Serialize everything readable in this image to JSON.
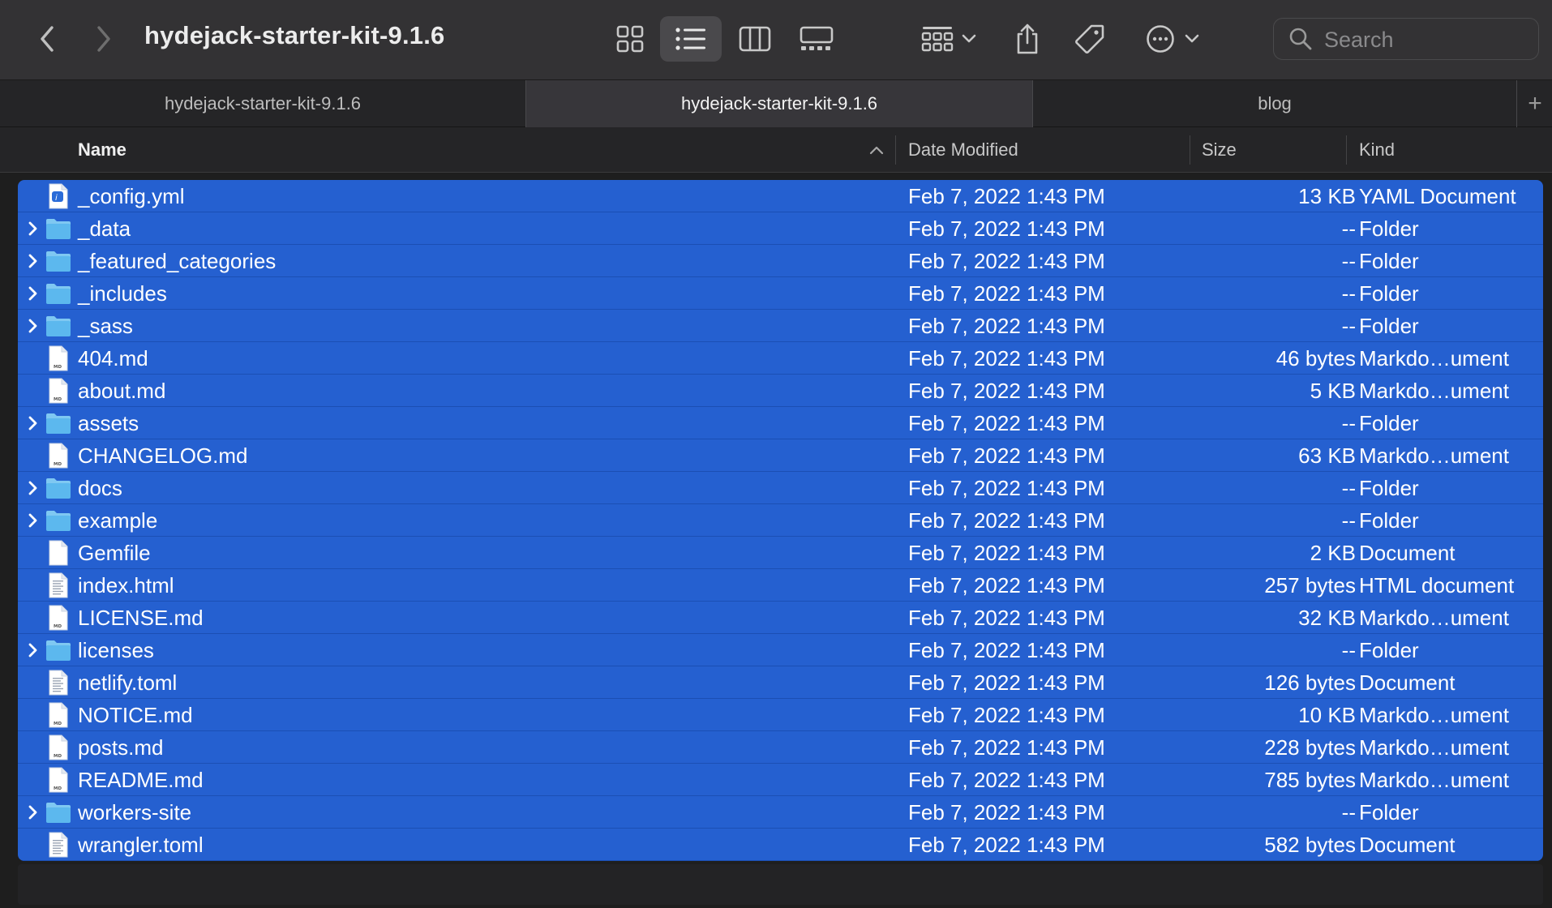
{
  "window": {
    "title": "hydejack-starter-kit-9.1.6"
  },
  "toolbar": {
    "back_icon": "chevron-left-icon",
    "forward_icon": "chevron-right-icon",
    "view_modes": [
      "icon-view-icon",
      "list-view-icon",
      "column-view-icon",
      "gallery-view-icon"
    ],
    "active_view": "list-view-icon",
    "group_icon": "group-icon",
    "share_icon": "share-icon",
    "tag_icon": "tag-icon",
    "more_icon": "ellipsis-circle-icon",
    "search_placeholder": "Search"
  },
  "tabs": [
    {
      "label": "hydejack-starter-kit-9.1.6",
      "active": false
    },
    {
      "label": "hydejack-starter-kit-9.1.6",
      "active": true
    },
    {
      "label": "blog",
      "active": false
    }
  ],
  "add_tab": "+",
  "columns": {
    "name": "Name",
    "date": "Date Modified",
    "size": "Size",
    "kind": "Kind",
    "sort": "ascending"
  },
  "colors": {
    "selection": "#2560d0",
    "folder": "#5cb8ee",
    "window_bg": "#1e1e1e"
  },
  "files": [
    {
      "name": "_config.yml",
      "date": "Feb 7, 2022 1:43 PM",
      "size": "13 KB",
      "kind": "YAML Document",
      "type": "yaml"
    },
    {
      "name": "_data",
      "date": "Feb 7, 2022 1:43 PM",
      "size": "--",
      "kind": "Folder",
      "type": "folder"
    },
    {
      "name": "_featured_categories",
      "date": "Feb 7, 2022 1:43 PM",
      "size": "--",
      "kind": "Folder",
      "type": "folder"
    },
    {
      "name": "_includes",
      "date": "Feb 7, 2022 1:43 PM",
      "size": "--",
      "kind": "Folder",
      "type": "folder"
    },
    {
      "name": "_sass",
      "date": "Feb 7, 2022 1:43 PM",
      "size": "--",
      "kind": "Folder",
      "type": "folder"
    },
    {
      "name": "404.md",
      "date": "Feb 7, 2022 1:43 PM",
      "size": "46 bytes",
      "kind": "Markdo…ument",
      "type": "md"
    },
    {
      "name": "about.md",
      "date": "Feb 7, 2022 1:43 PM",
      "size": "5 KB",
      "kind": "Markdo…ument",
      "type": "md"
    },
    {
      "name": "assets",
      "date": "Feb 7, 2022 1:43 PM",
      "size": "--",
      "kind": "Folder",
      "type": "folder"
    },
    {
      "name": "CHANGELOG.md",
      "date": "Feb 7, 2022 1:43 PM",
      "size": "63 KB",
      "kind": "Markdo…ument",
      "type": "md"
    },
    {
      "name": "docs",
      "date": "Feb 7, 2022 1:43 PM",
      "size": "--",
      "kind": "Folder",
      "type": "folder"
    },
    {
      "name": "example",
      "date": "Feb 7, 2022 1:43 PM",
      "size": "--",
      "kind": "Folder",
      "type": "folder"
    },
    {
      "name": "Gemfile",
      "date": "Feb 7, 2022 1:43 PM",
      "size": "2 KB",
      "kind": "Document",
      "type": "blank"
    },
    {
      "name": "index.html",
      "date": "Feb 7, 2022 1:43 PM",
      "size": "257 bytes",
      "kind": "HTML document",
      "type": "html"
    },
    {
      "name": "LICENSE.md",
      "date": "Feb 7, 2022 1:43 PM",
      "size": "32 KB",
      "kind": "Markdo…ument",
      "type": "md"
    },
    {
      "name": "licenses",
      "date": "Feb 7, 2022 1:43 PM",
      "size": "--",
      "kind": "Folder",
      "type": "folder"
    },
    {
      "name": "netlify.toml",
      "date": "Feb 7, 2022 1:43 PM",
      "size": "126 bytes",
      "kind": "Document",
      "type": "text"
    },
    {
      "name": "NOTICE.md",
      "date": "Feb 7, 2022 1:43 PM",
      "size": "10 KB",
      "kind": "Markdo…ument",
      "type": "md"
    },
    {
      "name": "posts.md",
      "date": "Feb 7, 2022 1:43 PM",
      "size": "228 bytes",
      "kind": "Markdo…ument",
      "type": "md"
    },
    {
      "name": "README.md",
      "date": "Feb 7, 2022 1:43 PM",
      "size": "785 bytes",
      "kind": "Markdo…ument",
      "type": "md"
    },
    {
      "name": "workers-site",
      "date": "Feb 7, 2022 1:43 PM",
      "size": "--",
      "kind": "Folder",
      "type": "folder"
    },
    {
      "name": "wrangler.toml",
      "date": "Feb 7, 2022 1:43 PM",
      "size": "582 bytes",
      "kind": "Document",
      "type": "text"
    }
  ]
}
